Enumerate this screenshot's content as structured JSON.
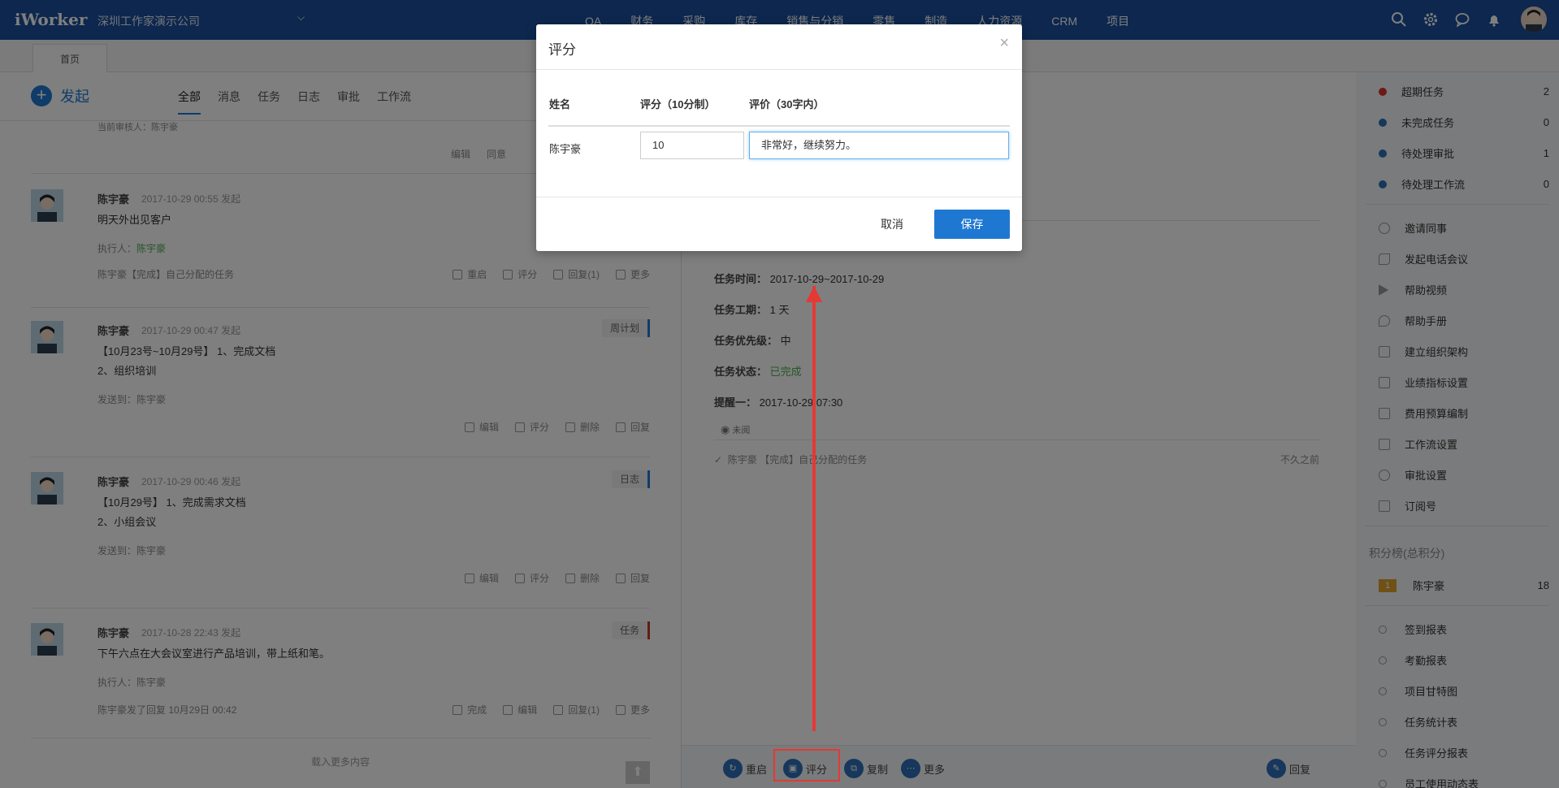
{
  "topbar": {
    "logo": "iWorker",
    "company": "深圳工作家演示公司",
    "nav": [
      "OA",
      "财务",
      "采购",
      "库存",
      "销售与分销",
      "零售",
      "制造",
      "人力资源",
      "CRM",
      "项目"
    ]
  },
  "tabs": {
    "home": "首页"
  },
  "feed": {
    "launch_label": "发起",
    "filters": [
      "全部",
      "消息",
      "任务",
      "日志",
      "审批",
      "工作流"
    ],
    "partial_approver": "当前审核人：陈宇豪",
    "partial_actions": [
      "编辑",
      "同意"
    ],
    "posts": [
      {
        "name": "陈宇豪",
        "time": "2017-10-29 00:55 发起",
        "lines": [
          "明天外出见客户"
        ],
        "meta_label": "执行人：",
        "meta_value": "陈宇豪",
        "footer": "陈宇豪【完成】自己分配的任务",
        "tag": "",
        "actions": [
          "重启",
          "评分",
          "回复(1)",
          "更多"
        ]
      },
      {
        "name": "陈宇豪",
        "time": "2017-10-29 00:47 发起",
        "lines": [
          "【10月23号~10月29号】 1、完成文档",
          "2、组织培训"
        ],
        "meta_label": "发送到：",
        "meta_value": "陈宇豪",
        "footer": "",
        "tag": "周计划",
        "actions": [
          "编辑",
          "评分",
          "删除",
          "回复"
        ]
      },
      {
        "name": "陈宇豪",
        "time": "2017-10-29 00:46 发起",
        "lines": [
          "【10月29号】 1、完成需求文档",
          "2、小组会议"
        ],
        "meta_label": "发送到：",
        "meta_value": "陈宇豪",
        "footer": "",
        "tag": "日志",
        "actions": [
          "编辑",
          "评分",
          "删除",
          "回复"
        ]
      },
      {
        "name": "陈宇豪",
        "time": "2017-10-28 22:43 发起",
        "lines": [
          "下午六点在大会议室进行产品培训，带上纸和笔。"
        ],
        "meta_label": "执行人：",
        "meta_value": "陈宇豪",
        "footer": "陈宇豪发了回复  10月29日 00:42",
        "tag": "任务",
        "actions": [
          "完成",
          "编辑",
          "回复(1)",
          "更多"
        ]
      }
    ],
    "load_more": "载入更多内容"
  },
  "detail": {
    "time_label": "任务时间：",
    "time_value": "2017-10-29~2017-10-29",
    "duration_label": "任务工期：",
    "duration_value": "1 天",
    "priority_label": "任务优先级：",
    "priority_value": "中",
    "status_label": "任务状态：",
    "status_value": "已完成",
    "remind_label": "提醒一：",
    "remind_value": "2017-10-29 07:30",
    "unread": "未阅",
    "log_text": "陈宇豪  【完成】自己分配的任务",
    "log_time": "不久之前",
    "bottom": {
      "restart": "重启",
      "score": "评分",
      "copy": "复制",
      "more": "更多",
      "reply": "回复"
    }
  },
  "sidebar": {
    "stats": [
      {
        "label": "超期任务",
        "count": "2",
        "color": "#d9342b"
      },
      {
        "label": "未完成任务",
        "count": "0",
        "color": "#2f6fb8"
      },
      {
        "label": "待处理审批",
        "count": "1",
        "color": "#2f6fb8"
      },
      {
        "label": "待处理工作流",
        "count": "0",
        "color": "#2f6fb8"
      }
    ],
    "tools": [
      "邀请同事",
      "发起电话会议",
      "帮助视频",
      "帮助手册",
      "建立组织架构",
      "业绩指标设置",
      "费用预算编制",
      "工作流设置",
      "审批设置",
      "订阅号"
    ],
    "rank_title": "积分榜(总积分)",
    "rank": [
      {
        "pos": "1",
        "name": "陈宇豪",
        "score": "18"
      }
    ],
    "reports": [
      "签到报表",
      "考勤报表",
      "项目甘特图",
      "任务统计表",
      "任务评分报表",
      "员工使用动态表"
    ]
  },
  "modal": {
    "title": "评分",
    "col_name": "姓名",
    "col_score": "评分（10分制）",
    "col_comment": "评价（30字内）",
    "row_name": "陈宇豪",
    "score_value": "10",
    "comment_value": "非常好，继续努力。",
    "cancel": "取消",
    "save": "保存"
  }
}
